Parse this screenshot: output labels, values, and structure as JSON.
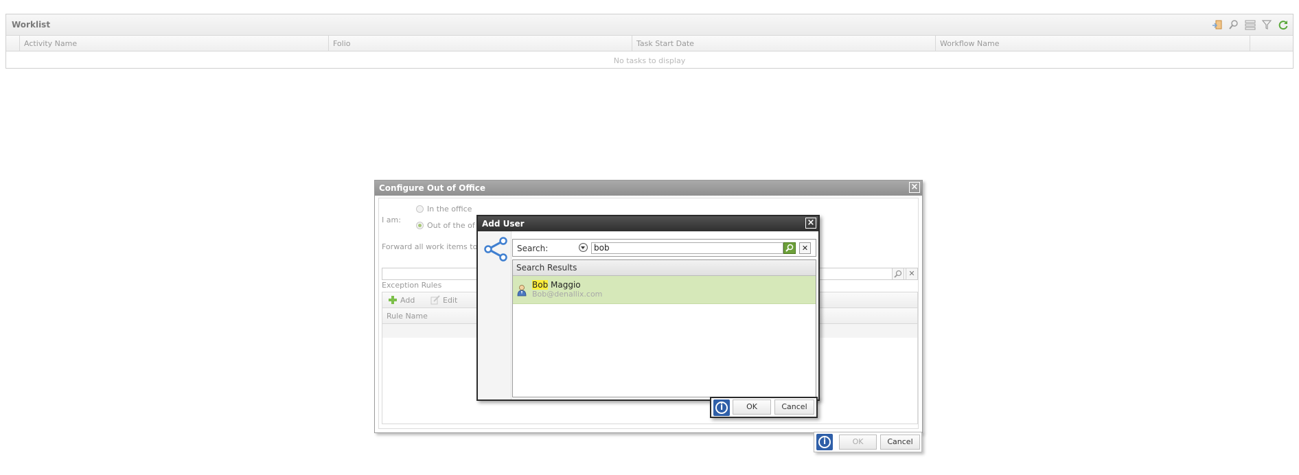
{
  "worklist": {
    "title": "Worklist",
    "columns": [
      "Activity Name",
      "Folio",
      "Task Start Date",
      "Workflow Name"
    ],
    "empty_message": "No tasks to display",
    "tool_icons": [
      "export-icon",
      "search-icon",
      "view-options-icon",
      "filter-icon",
      "refresh-icon"
    ]
  },
  "out_of_office": {
    "title": "Configure Out of Office",
    "i_am_label": "I am:",
    "option_in": "In the office",
    "option_out": "Out of the of",
    "forward_label": "Forward all work items to",
    "forward_value": "",
    "exception_rules_label": "Exception Rules",
    "add_label": "Add",
    "edit_label": "Edit",
    "column_rule_name": "Rule Name",
    "ok_label": "OK",
    "cancel_label": "Cancel",
    "selected_option": "out"
  },
  "add_user": {
    "title": "Add User",
    "search_label": "Search:",
    "search_value": "bob",
    "results_header": "Search Results",
    "results": [
      {
        "first_name": "Bob",
        "last_name": " Maggio",
        "email": "Bob@denallix.com"
      }
    ],
    "ok_label": "OK",
    "cancel_label": "Cancel"
  },
  "colors": {
    "selected_row": "#d6e8b9",
    "highlight": "#ffef3a",
    "info_button": "#2f5fa8",
    "add_user_title_bar": "#3a3a3a",
    "ooo_title_bar": "#9b9b9b"
  }
}
